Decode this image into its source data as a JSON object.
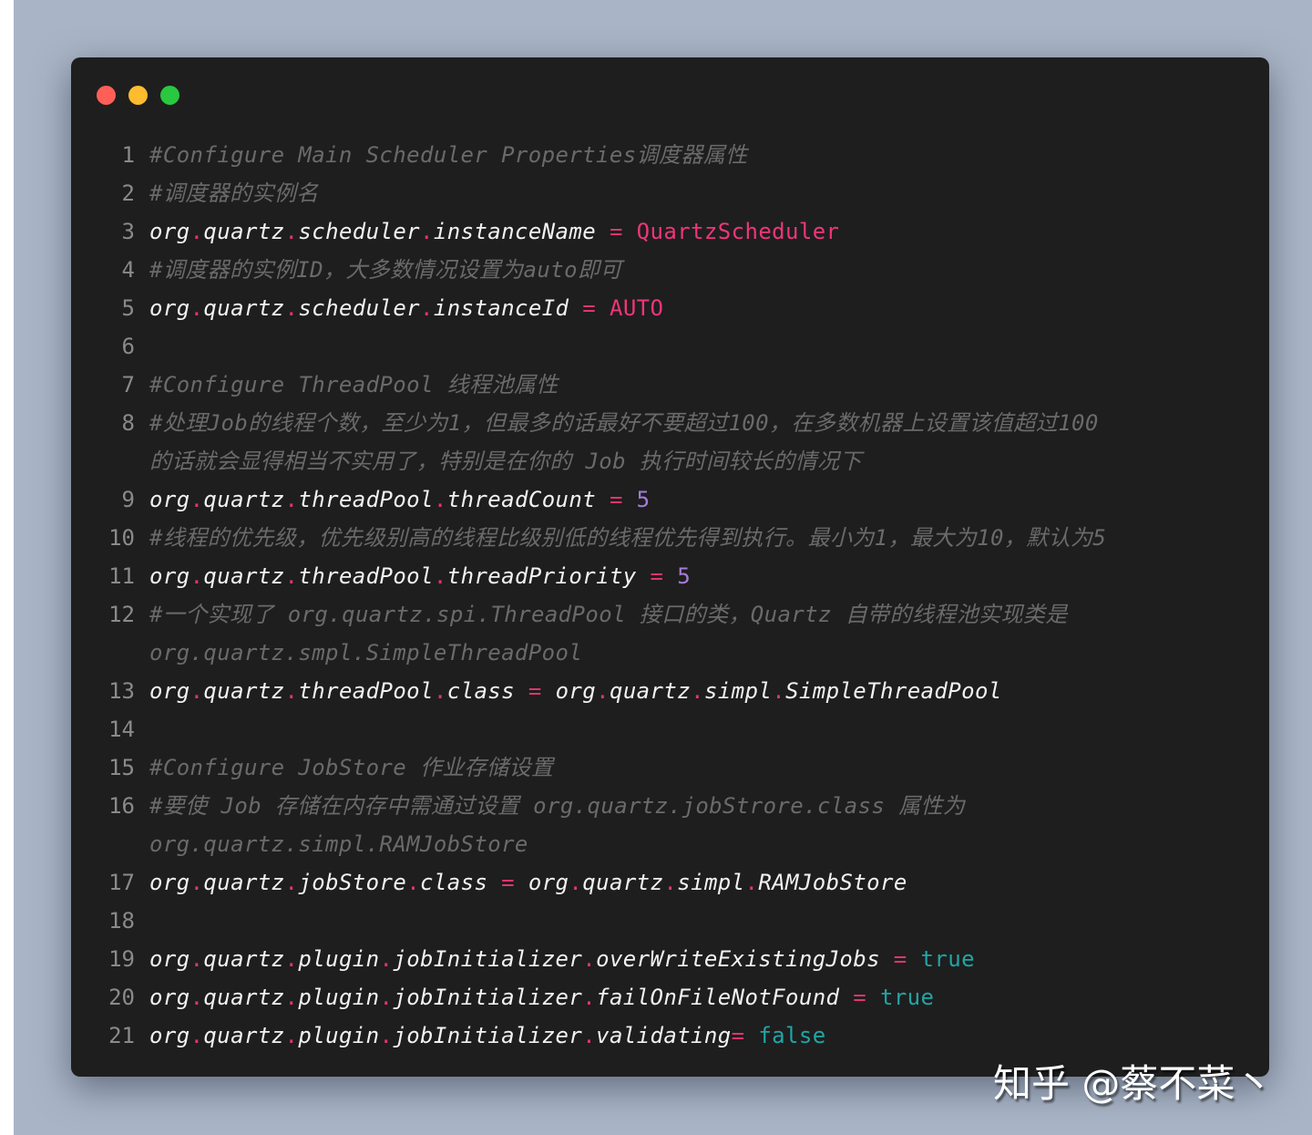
{
  "window": {
    "controls": [
      {
        "name": "close",
        "color": "#ff5f57"
      },
      {
        "name": "minimize",
        "color": "#febc2e"
      },
      {
        "name": "maximize",
        "color": "#28c840"
      }
    ]
  },
  "lines": [
    {
      "n": "1",
      "comment": "#Configure Main Scheduler Properties调度器属性"
    },
    {
      "n": "2",
      "comment": "#调度器的实例名"
    },
    {
      "n": "3",
      "key": "org.quartz.scheduler.instanceName",
      "eq": " = ",
      "value": "QuartzScheduler",
      "vtype": "string"
    },
    {
      "n": "4",
      "comment": "#调度器的实例ID，大多数情况设置为auto即可"
    },
    {
      "n": "5",
      "key": "org.quartz.scheduler.instanceId",
      "eq": " = ",
      "value": "AUTO",
      "vtype": "string"
    },
    {
      "n": "6"
    },
    {
      "n": "7",
      "comment": "#Configure ThreadPool     线程池属性"
    },
    {
      "n": "8",
      "comment": "#处理Job的线程个数，至少为1，但最多的话最好不要超过100，在多数机器上设置该值超过100"
    },
    {
      "n": "",
      "comment": "的话就会显得相当不实用了，特别是在你的 Job 执行时间较长的情况下"
    },
    {
      "n": "9",
      "key": "org.quartz.threadPool.threadCount",
      "eq": " =  ",
      "value": "5",
      "vtype": "number"
    },
    {
      "n": "10",
      "comment": "#线程的优先级，优先级别高的线程比级别低的线程优先得到执行。最小为1，最大为10，默认为5"
    },
    {
      "n": "11",
      "key": "org.quartz.threadPool.threadPriority",
      "eq": " = ",
      "value": "5",
      "vtype": "number"
    },
    {
      "n": "12",
      "comment": "#一个实现了 org.quartz.spi.ThreadPool 接口的类，Quartz 自带的线程池实现类是"
    },
    {
      "n": "",
      "comment": "org.quartz.smpl.SimpleThreadPool"
    },
    {
      "n": "13",
      "key": "org.quartz.threadPool.class",
      "eq": " = ",
      "value": "org.quartz.simpl.SimpleThreadPool",
      "vtype": "class"
    },
    {
      "n": "14"
    },
    {
      "n": "15",
      "comment": "#Configure JobStore 作业存储设置"
    },
    {
      "n": "16",
      "comment": "#要使 Job 存储在内存中需通过设置  org.quartz.jobStrore.class 属性为"
    },
    {
      "n": "",
      "comment": "org.quartz.simpl.RAMJobStore"
    },
    {
      "n": "17",
      "key": "org.quartz.jobStore.class",
      "eq": " = ",
      "value": "org.quartz.simpl.RAMJobStore",
      "vtype": "class"
    },
    {
      "n": "18"
    },
    {
      "n": "19",
      "key": "org.quartz.plugin.jobInitializer.overWriteExistingJobs",
      "eq": " = ",
      "value": "true",
      "vtype": "bool"
    },
    {
      "n": "20",
      "key": "org.quartz.plugin.jobInitializer.failOnFileNotFound",
      "eq": " = ",
      "value": "true",
      "vtype": "bool"
    },
    {
      "n": "21",
      "key": "org.quartz.plugin.jobInitializer.validating",
      "eq": "= ",
      "value": "false",
      "vtype": "bool"
    }
  ],
  "watermark": "知乎 @蔡不菜丶"
}
